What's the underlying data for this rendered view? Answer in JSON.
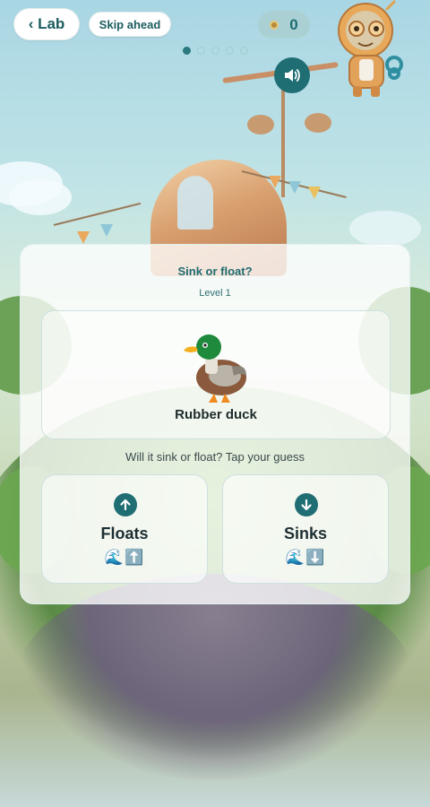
{
  "topbar": {
    "back_label": "‹ Lab",
    "skip_label": "Skip ahead",
    "coins": "0",
    "progress_total": 5,
    "progress_current": 1
  },
  "card": {
    "title": "Sink or float?",
    "level": "Level 1",
    "item": {
      "name": "Rubber duck",
      "icon": "duck-icon"
    },
    "prompt": "Will it sink or float? Tap your guess",
    "choices": [
      {
        "label": "Floats",
        "icon": "arrow-up-icon",
        "emoji": "🌊⬆️"
      },
      {
        "label": "Sinks",
        "icon": "arrow-down-icon",
        "emoji": "🌊⬇️"
      }
    ]
  },
  "colors": {
    "accent": "#1f6e74",
    "title": "#1f6b70"
  }
}
